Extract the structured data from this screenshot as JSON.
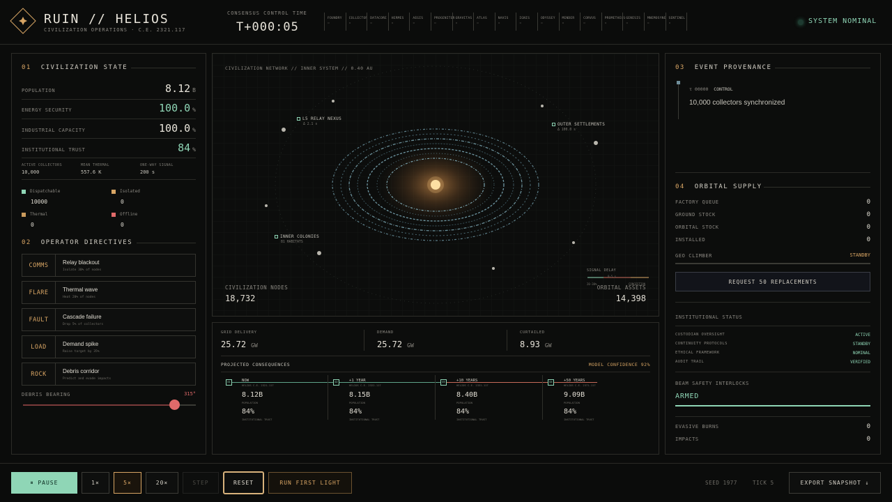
{
  "header": {
    "title": "RUIN // HELIOS",
    "subtitle": "CIVILIZATION OPERATIONS · C.E. 2321.117",
    "clock_label": "CONSENSUS CONTROL TIME",
    "clock_value": "T+000:05",
    "collectors": [
      {
        "name": "FOUNDRY",
        "sub": "▫"
      },
      {
        "name": "COLLECTOR",
        "sub": "▫"
      },
      {
        "name": "DATACORE",
        "sub": "▫"
      },
      {
        "name": "HERMES",
        "sub": "▫"
      },
      {
        "name": "AEGIS",
        "sub": "▫"
      },
      {
        "name": "PROGENITOR",
        "sub": "▫"
      },
      {
        "name": "GRAVITAS",
        "sub": "▫"
      },
      {
        "name": "ATLAS",
        "sub": "▫"
      },
      {
        "name": "NAVIS",
        "sub": "▫"
      },
      {
        "name": "IGNIS",
        "sub": "▫"
      },
      {
        "name": "ODYSSEY",
        "sub": "▫"
      },
      {
        "name": "MENDER",
        "sub": "▫"
      },
      {
        "name": "CORVUS",
        "sub": "▫"
      },
      {
        "name": "PROMETHEUS",
        "sub": "▫"
      },
      {
        "name": "GENESIS",
        "sub": "▫"
      },
      {
        "name": "MNEMOSYNE",
        "sub": "▫"
      },
      {
        "name": "SENTINEL",
        "sub": "▫"
      }
    ],
    "system_status": "SYSTEM NOMINAL"
  },
  "civ_state": {
    "num": "01",
    "title": "CIVILIZATION STATE",
    "metrics": [
      {
        "label": "POPULATION",
        "value": "8.12",
        "unit": "B",
        "color": "#e8e4da"
      },
      {
        "label": "ENERGY SECURITY",
        "value": "100.0",
        "unit": "%",
        "color": "#8fd6b6"
      },
      {
        "label": "INDUSTRIAL CAPACITY",
        "value": "100.0",
        "unit": "%",
        "color": "#e8e4da"
      },
      {
        "label": "INSTITUTIONAL TRUST",
        "value": "84",
        "unit": "%",
        "color": "#8fd6b6"
      }
    ],
    "stats": [
      {
        "label": "ACTIVE COLLECTORS",
        "value": "10,000"
      },
      {
        "label": "MEAN THERMAL",
        "value": "557.6 K"
      },
      {
        "label": "ONE-WAY SIGNAL",
        "value": "200 s"
      }
    ],
    "legend": [
      {
        "label": "Dispatchable",
        "value": "10000",
        "color": "#8fd6b6"
      },
      {
        "label": "Isolated",
        "value": "0",
        "color": "#d8a564"
      },
      {
        "label": "Thermal",
        "value": "0",
        "color": "#d8a564"
      },
      {
        "label": "Offline",
        "value": "0",
        "color": "#e06a6a"
      }
    ]
  },
  "directives": {
    "num": "02",
    "title": "OPERATOR DIRECTIVES",
    "items": [
      {
        "code": "COMMS",
        "title": "Relay blackout",
        "desc": "Isolate 30% of nodes"
      },
      {
        "code": "FLARE",
        "title": "Thermal wave",
        "desc": "Heat 20% of nodes"
      },
      {
        "code": "FAULT",
        "title": "Cascade failure",
        "desc": "Drop 5% of collectors"
      },
      {
        "code": "LOAD",
        "title": "Demand spike",
        "desc": "Raise target by 35%"
      },
      {
        "code": "ROCK",
        "title": "Debris corridor",
        "desc": "Predict and evade impacts"
      }
    ],
    "bearing_label": "DEBRIS BEARING",
    "bearing_value": "315°",
    "bearing_fraction": 0.875
  },
  "map": {
    "title": "CIVILIZATION NETWORK // INNER SYSTEM // 0.40 AU",
    "labels": [
      {
        "name": "L5 RELAY NEXUS",
        "sub": "Δ 2.1 s"
      },
      {
        "name": "OUTER SETTLEMENTS",
        "sub": "Δ 100.0 s"
      },
      {
        "name": "INNER COLONIES",
        "sub": "81 HABITATS"
      }
    ],
    "signal_delay_label": "SIGNAL DELAY",
    "signal_delay_scale": [
      "20-30%",
      "0-5 s",
      "CONGESTION"
    ],
    "nodes_label": "CIVILIZATION NODES",
    "nodes_value": "18,732",
    "assets_label": "ORBITAL ASSETS",
    "assets_value": "14,398"
  },
  "grid": {
    "delivery_label": "GRID DELIVERY",
    "delivery_value": "25.72",
    "demand_label": "DEMAND",
    "demand_value": "25.72",
    "curtailed_label": "CURTAILED",
    "curtailed_value": "8.93",
    "unit": "GW",
    "projected_label": "PROJECTED CONSEQUENCES",
    "confidence_label": "MODEL CONFIDENCE 92%",
    "projections": [
      {
        "box": "01",
        "label": "NOW",
        "sub": "HELIOS C.E. 2321.117",
        "population": "8.12B",
        "trust": "84%"
      },
      {
        "box": "02",
        "label": "+1 YEAR",
        "sub": "HELIOS C.E. 2322.117",
        "population": "8.15B",
        "trust": "84%"
      },
      {
        "box": "03",
        "label": "+10 YEARS",
        "sub": "HELIOS C.E. 2331.117",
        "population": "8.40B",
        "trust": "84%"
      },
      {
        "box": "04",
        "label": "+50 YEARS",
        "sub": "HELIOS C.E. 2371.117",
        "population": "9.09B",
        "trust": "84%"
      }
    ],
    "population_caption": "POPULATION",
    "trust_caption": "INSTITUTIONAL TRUST"
  },
  "provenance": {
    "num": "03",
    "title": "EVENT PROVENANCE",
    "event_time": "τ 00000",
    "event_type": "CONTROL",
    "event_desc": "10,000 collectors synchronized"
  },
  "supply": {
    "num": "04",
    "title": "ORBITAL SUPPLY",
    "rows": [
      {
        "label": "FACTORY QUEUE",
        "value": "0"
      },
      {
        "label": "GROUND STOCK",
        "value": "0"
      },
      {
        "label": "ORBITAL STOCK",
        "value": "0"
      },
      {
        "label": "INSTALLED",
        "value": "0"
      }
    ],
    "geo_label": "GEO CLIMBER",
    "geo_value": "STANDBY",
    "request_button": "REQUEST 50 REPLACEMENTS",
    "inst_title": "INSTITUTIONAL STATUS",
    "inst_rows": [
      {
        "label": "CUSTODIAN OVERSIGHT",
        "value": "ACTIVE"
      },
      {
        "label": "CONTINUITY PROTOCOLS",
        "value": "STANDBY"
      },
      {
        "label": "ETHICAL FRAMEWORK",
        "value": "NOMINAL"
      },
      {
        "label": "AUDIT TRAIL",
        "value": "VERIFIED"
      }
    ],
    "beam_label": "BEAM SAFETY INTERLOCKS",
    "beam_value": "ARMED",
    "evasive_label": "EVASIVE BURNS",
    "evasive_value": "0",
    "impacts_label": "IMPACTS",
    "impacts_value": "0"
  },
  "footer": {
    "pause": "⏸ PAUSE",
    "speed_1": "1×",
    "speed_5": "5×",
    "speed_20": "20×",
    "step": "STEP",
    "reset": "RESET",
    "run": "RUN FIRST LIGHT",
    "seed": "SEED 1977",
    "tick": "TICK 5",
    "export": "EXPORT SNAPSHOT ↓"
  },
  "colors": {
    "accent": "#d8a564",
    "green": "#8fd6b6",
    "red": "#e06a6a",
    "background": "#0b0c0b"
  }
}
